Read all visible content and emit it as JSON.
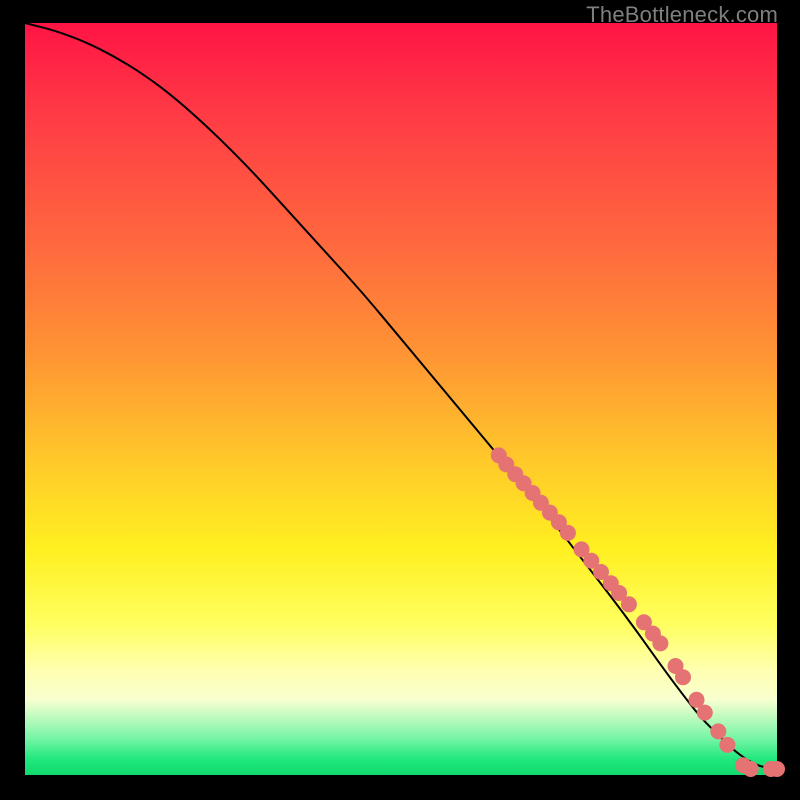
{
  "watermark": "TheBottleneck.com",
  "colors": {
    "dot": "#e57373",
    "curve": "#000000",
    "frame": "#000000"
  },
  "chart_data": {
    "type": "line",
    "title": "",
    "xlabel": "",
    "ylabel": "",
    "xlim": [
      0,
      100
    ],
    "ylim": [
      0,
      100
    ],
    "grid": false,
    "legend": false,
    "series": [
      {
        "name": "bottleneck-curve",
        "x": [
          0,
          4,
          8,
          12,
          16,
          20,
          25,
          30,
          35,
          40,
          45,
          50,
          55,
          60,
          65,
          70,
          75,
          80,
          85,
          88,
          90,
          92,
          94,
          96,
          98,
          100
        ],
        "y": [
          100,
          99,
          97.5,
          95.5,
          93,
          90,
          85.5,
          80.5,
          75,
          69.5,
          64,
          58,
          52,
          46,
          40,
          34,
          27.5,
          21,
          14,
          10,
          7.5,
          5.5,
          3.5,
          2,
          1,
          1
        ]
      }
    ],
    "scatter_points": {
      "name": "highlighted-segment",
      "points": [
        {
          "x": 63,
          "y": 42.5
        },
        {
          "x": 64,
          "y": 41.3
        },
        {
          "x": 65.2,
          "y": 40
        },
        {
          "x": 66.3,
          "y": 38.8
        },
        {
          "x": 67.5,
          "y": 37.5
        },
        {
          "x": 68.6,
          "y": 36.2
        },
        {
          "x": 69.8,
          "y": 34.9
        },
        {
          "x": 71,
          "y": 33.6
        },
        {
          "x": 72.2,
          "y": 32.2
        },
        {
          "x": 74,
          "y": 30
        },
        {
          "x": 75.3,
          "y": 28.5
        },
        {
          "x": 76.6,
          "y": 27
        },
        {
          "x": 77.9,
          "y": 25.5
        },
        {
          "x": 79,
          "y": 24.2
        },
        {
          "x": 80.3,
          "y": 22.7
        },
        {
          "x": 82.3,
          "y": 20.3
        },
        {
          "x": 83.5,
          "y": 18.8
        },
        {
          "x": 84.5,
          "y": 17.5
        },
        {
          "x": 86.5,
          "y": 14.5
        },
        {
          "x": 87.5,
          "y": 13
        },
        {
          "x": 89.3,
          "y": 10
        },
        {
          "x": 90.4,
          "y": 8.3
        },
        {
          "x": 92.2,
          "y": 5.8
        },
        {
          "x": 93.4,
          "y": 4
        },
        {
          "x": 95.5,
          "y": 1.3
        },
        {
          "x": 96.5,
          "y": 0.8
        },
        {
          "x": 99.2,
          "y": 0.8
        },
        {
          "x": 100,
          "y": 0.8
        }
      ]
    },
    "dot_radius_px": 8
  }
}
